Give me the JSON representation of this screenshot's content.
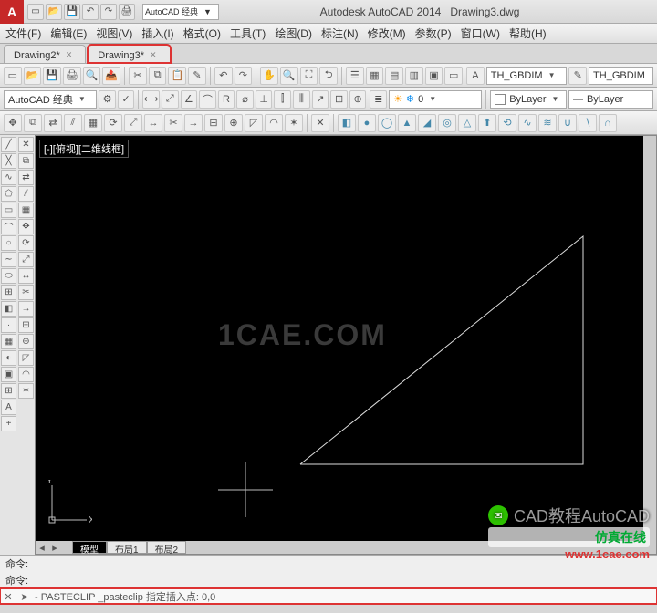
{
  "title": {
    "app": "Autodesk AutoCAD 2014",
    "doc": "Drawing3.dwg"
  },
  "qat_search": "AutoCAD 经典",
  "menus": [
    "文件(F)",
    "编辑(E)",
    "视图(V)",
    "插入(I)",
    "格式(O)",
    "工具(T)",
    "绘图(D)",
    "标注(N)",
    "修改(M)",
    "参数(P)",
    "窗口(W)",
    "帮助(H)"
  ],
  "doc_tabs": [
    {
      "label": "Drawing2*",
      "highlighted": false
    },
    {
      "label": "Drawing3*",
      "highlighted": true
    }
  ],
  "row1": {
    "style1": "TH_GBDIM",
    "style2": "TH_GBDIM"
  },
  "row2": {
    "workspace": "AutoCAD 经典",
    "layer": "0",
    "linestyle": "ByLayer",
    "linetype": "ByLayer"
  },
  "viewport_label": "[-][俯视][二维线框]",
  "watermark": "1CAE.COM",
  "ucs": {
    "x": "X",
    "y": "Y"
  },
  "layout_tabs": [
    "模型",
    "布局1",
    "布局2"
  ],
  "cmd": {
    "line1": "命令:",
    "line2": "命令:",
    "prompt_icon": "➤",
    "prompt": "- PASTECLIP _pasteclip 指定插入点: 0,0"
  },
  "overlay": {
    "l1": "CAD教程AutoCAD",
    "l2": "仿真在线",
    "l3": "www.1cae.com"
  }
}
